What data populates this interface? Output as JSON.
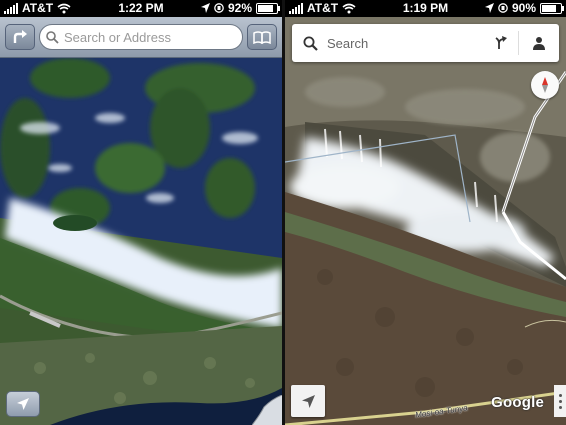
{
  "left_phone": {
    "status": {
      "carrier": "AT&T",
      "time": "1:22 PM",
      "battery": "92%",
      "battery_level": 0.92
    },
    "toolbar": {
      "search_placeholder": "Search or Address",
      "directions_icon": "turn-right-arrow-icon",
      "bookmarks_icon": "open-book-icon"
    },
    "controls": {
      "locate_icon": "location-arrow-icon",
      "page_curl_icon": "page-curl-icon"
    }
  },
  "right_phone": {
    "status": {
      "carrier": "AT&T",
      "time": "1:19 PM",
      "battery": "90%",
      "battery_level": 0.9
    },
    "searchbar": {
      "placeholder": "Search",
      "directions_icon": "directions-fork-icon",
      "profile_icon": "person-icon"
    },
    "controls": {
      "compass_icon": "compass-icon",
      "locate_icon": "location-arrow-icon",
      "more_icon": "more-vertical-icon"
    },
    "map": {
      "road_label": "Mosi-oa-Tunya",
      "watermark": "Google"
    }
  },
  "colors": {
    "toolbar_old": "#9ba7b6",
    "compass_red": "#d9342b"
  }
}
